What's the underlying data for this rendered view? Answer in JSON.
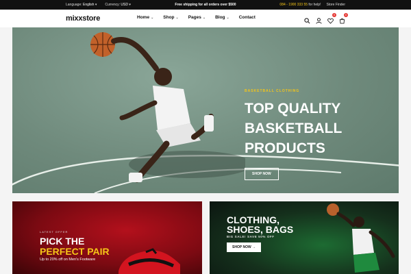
{
  "topbar": {
    "language_label": "Language:",
    "language_value": "English",
    "currency_label": "Currency:",
    "currency_value": "USD",
    "shipping": "Free shipping for all orders over $500",
    "phone": "084 - 1900 333 55",
    "phone_suffix": "for help!",
    "store_finder": "Store Finder"
  },
  "header": {
    "logo": "mixxstore",
    "nav": [
      {
        "label": "Home"
      },
      {
        "label": "Shop"
      },
      {
        "label": "Pages"
      },
      {
        "label": "Blog"
      },
      {
        "label": "Contact"
      }
    ],
    "icons": [
      "search-icon",
      "user-icon",
      "heart-icon",
      "cart-icon"
    ],
    "wishlist_count": "0",
    "cart_count": "0"
  },
  "hero": {
    "eyebrow": "BASKETBALL CLOTHING",
    "title_line1": "TOP QUALITY",
    "title_line2": "BASKETBALL",
    "title_line3": "PRODUCTS",
    "button": "SHOP NOW"
  },
  "promo_left": {
    "eyebrow": "LATEST OFFER",
    "title_line1": "PICK THE",
    "title_line2": "PERFECT PAIR",
    "subtitle": "Up to 20% off on Men's Footware"
  },
  "promo_right": {
    "title_line1": "CLOTHING,",
    "title_line2": "SHOES, BAGS",
    "subtitle": "BIG SALE! SAVE 50% OFF",
    "button": "SHOP NOW"
  },
  "colors": {
    "accent": "#f5c518",
    "hero_bg": "#6f8a7c",
    "promo_left_bg": "#b3101c",
    "promo_right_bg": "#1d6b32"
  }
}
